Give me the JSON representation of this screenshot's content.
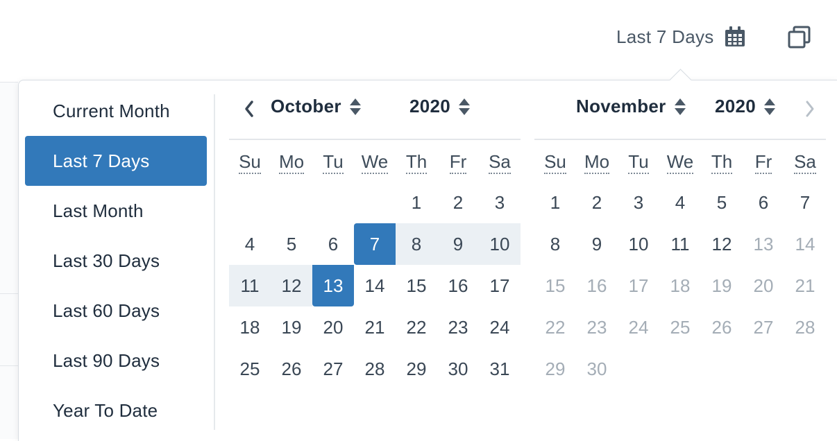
{
  "trigger": {
    "label": "Last 7 Days",
    "icon": "calendar-icon"
  },
  "copy_button": {
    "icon": "copy-icon"
  },
  "colors": {
    "accent": "#3279ba",
    "range_bg": "#ebf0f4",
    "muted": "#a4adb6"
  },
  "presets": [
    {
      "label": "Current Month",
      "active": false
    },
    {
      "label": "Last 7 Days",
      "active": true
    },
    {
      "label": "Last Month",
      "active": false
    },
    {
      "label": "Last 30 Days",
      "active": false
    },
    {
      "label": "Last 60 Days",
      "active": false
    },
    {
      "label": "Last 90 Days",
      "active": false
    },
    {
      "label": "Year To Date",
      "active": false
    }
  ],
  "weekdays": [
    "Su",
    "Mo",
    "Tu",
    "We",
    "Th",
    "Fr",
    "Sa"
  ],
  "months": [
    {
      "month": "October",
      "year": "2020",
      "lead_blanks": 4,
      "days": 31,
      "muted_from": 32
    },
    {
      "month": "November",
      "year": "2020",
      "lead_blanks": 0,
      "days": 30,
      "muted_from": 13
    }
  ],
  "selection": {
    "month_index": 0,
    "start": 7,
    "end": 13
  }
}
